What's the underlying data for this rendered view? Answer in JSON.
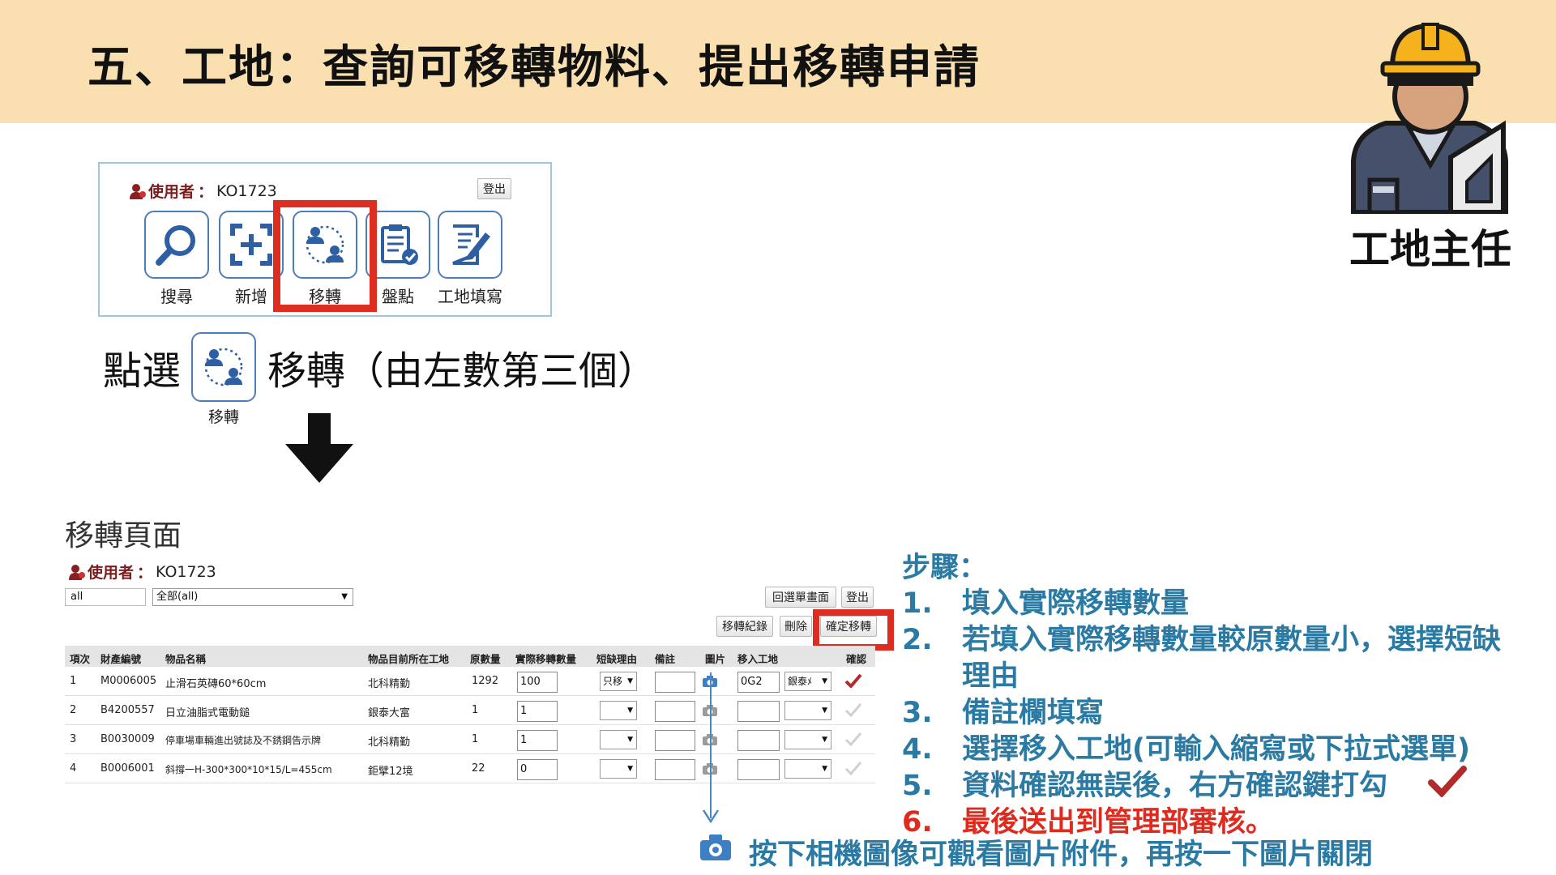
{
  "header": {
    "title": "五、工地：查詢可移轉物料、提出移轉申請"
  },
  "worker": {
    "caption": "工地主任",
    "icon": "construction-worker-icon"
  },
  "menu_panel": {
    "user_label": "使用者",
    "user_sep": "：",
    "user_id": "KO1723",
    "logout": "登出",
    "items": [
      {
        "label": "搜尋",
        "icon": "search-icon"
      },
      {
        "label": "新增",
        "icon": "add-icon"
      },
      {
        "label": "移轉",
        "icon": "transfer-icon"
      },
      {
        "label": "盤點",
        "icon": "inventory-icon"
      },
      {
        "label": "工地填寫",
        "icon": "edit-form-icon"
      }
    ]
  },
  "instruction": {
    "prefix": "點選",
    "tile_label": "移轉",
    "suffix": "移轉（由左數第三個）"
  },
  "transfer_page": {
    "title": "移轉頁面",
    "user_label": "使用者",
    "user_sep": "：",
    "user_id": "KO1723",
    "filter_code": "all",
    "filter_select": "全部(all)",
    "buttons": {
      "back_to_menu": "回選單畫面",
      "logout": "登出",
      "history": "移轉紀錄",
      "delete": "刪除",
      "confirm_transfer": "確定移轉"
    },
    "columns": [
      "項次",
      "財產編號",
      "物品名稱",
      "物品目前所在工地",
      "原數量",
      "實際移轉數量",
      "短缺理由",
      "備註",
      "圖片",
      "移入工地",
      "確認"
    ],
    "rows": [
      {
        "no": "1",
        "code": "M0006005",
        "name": "止滑石英磚60*60cm",
        "site": "北科精勤",
        "qty": "1292",
        "actual": "100",
        "reason": "只移",
        "note": "",
        "dest": "0G2",
        "dest_select": "銀泰ﾒ",
        "confirmed": true
      },
      {
        "no": "2",
        "code": "B4200557",
        "name": "日立油脂式電動鎚",
        "site": "銀泰大富",
        "qty": "1",
        "actual": "1",
        "reason": "",
        "note": "",
        "dest": "",
        "dest_select": "",
        "confirmed": false
      },
      {
        "no": "3",
        "code": "B0030009",
        "name": "停車場車輛進出號誌及不銹鋼告示牌",
        "site": "北科精勤",
        "qty": "1",
        "actual": "1",
        "reason": "",
        "note": "",
        "dest": "",
        "dest_select": "",
        "confirmed": false
      },
      {
        "no": "4",
        "code": "B0006001",
        "name": "斜撐一H-300*300*10*15/L=455cm",
        "site": "鉅擘12境",
        "qty": "22",
        "actual": "0",
        "reason": "",
        "note": "",
        "dest": "",
        "dest_select": "",
        "confirmed": false
      }
    ]
  },
  "steps": {
    "title": "步驟：",
    "items": [
      {
        "num": "1.",
        "text": "填入實際移轉數量"
      },
      {
        "num": "2.",
        "text": "若填入實際移轉數量較原數量小，選擇短缺"
      },
      {
        "num": "",
        "text": "理由"
      },
      {
        "num": "3.",
        "text": "備註欄填寫"
      },
      {
        "num": "4.",
        "text": "選擇移入工地(可輸入縮寫或下拉式選單)"
      },
      {
        "num": "5.",
        "text": "資料確認無誤後，右方確認鍵打勾"
      },
      {
        "num": "6.",
        "text": "最後送出到管理部審核。"
      }
    ]
  },
  "camera_note": "按下相機圖像可觀看圖片附件，再按一下圖片關閉",
  "colors": {
    "header_bg": "#fae0b0",
    "highlight": "#dc2d20",
    "step_blue": "#2a7aa3",
    "step_red": "#e02a1e",
    "tile_border": "#4f7db8"
  }
}
